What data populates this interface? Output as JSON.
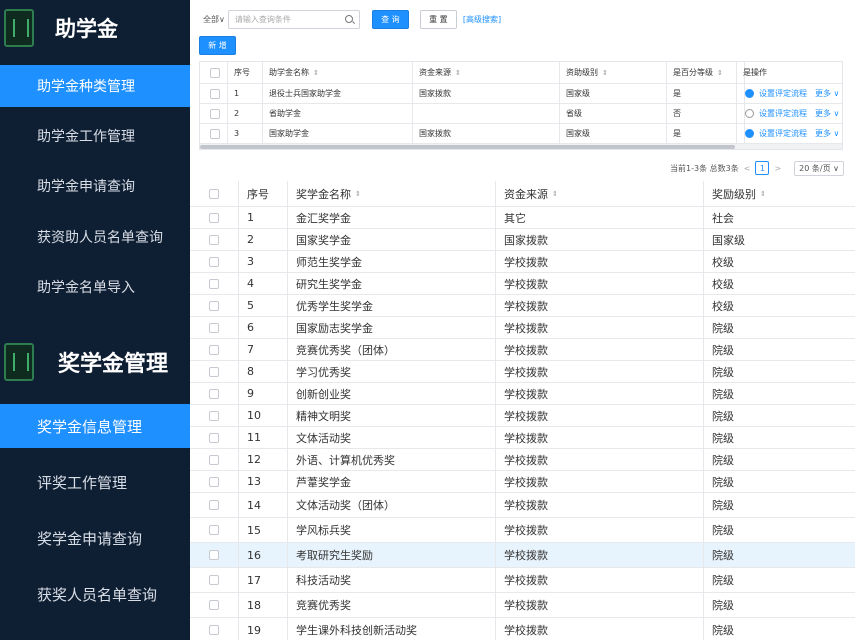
{
  "sidebar": {
    "section1_title": "助学金",
    "section1_items": [
      {
        "label": "助学金种类管理",
        "active": true
      },
      {
        "label": "助学金工作管理",
        "active": false
      },
      {
        "label": "助学金申请查询",
        "active": false
      },
      {
        "label": "获资助人员名单查询",
        "active": false
      },
      {
        "label": "助学金名单导入",
        "active": false
      }
    ],
    "section2_title": "奖学金管理",
    "section2_items": [
      {
        "label": "奖学金信息管理",
        "active": true
      },
      {
        "label": "评奖工作管理",
        "active": false
      },
      {
        "label": "奖学金申请查询",
        "active": false
      },
      {
        "label": "获奖人员名单查询",
        "active": false
      }
    ]
  },
  "toolbar": {
    "scope_label": "全部",
    "search_placeholder": "请输入查询条件",
    "query_label": "查 询",
    "reset_label": "重 置",
    "advanced_label": "[高级搜索]",
    "new_label": "新 增"
  },
  "grant_table": {
    "headers": [
      "序号",
      "助学金名称",
      "资金来源",
      "资助级别",
      "是百分等级",
      "是",
      "操作"
    ],
    "rows": [
      {
        "no": "1",
        "name": "退役士兵国家助学金",
        "source": "国家拨款",
        "level": "国家级",
        "percent": "是",
        "toggle": true,
        "action": "设置评定流程",
        "more": "更多"
      },
      {
        "no": "2",
        "name": "省助学金",
        "source": "",
        "level": "省级",
        "percent": "否",
        "toggle": false,
        "action": "设置评定流程",
        "more": "更多"
      },
      {
        "no": "3",
        "name": "国家助学金",
        "source": "国家拨款",
        "level": "国家级",
        "percent": "是",
        "toggle": true,
        "action": "设置评定流程",
        "more": "更多"
      }
    ]
  },
  "pager": {
    "summary": "当前1-3条 总数3条",
    "prev": "<",
    "current": "1",
    "next": ">",
    "size": "20 条/页"
  },
  "scholarship_table": {
    "headers": [
      "序号",
      "奖学金名称",
      "资金来源",
      "奖励级别"
    ],
    "rows": [
      {
        "no": "1",
        "name": "金汇奖学金",
        "source": "其它",
        "level": "社会"
      },
      {
        "no": "2",
        "name": "国家奖学金",
        "source": "国家拨款",
        "level": "国家级"
      },
      {
        "no": "3",
        "name": "师范生奖学金",
        "source": "学校拨款",
        "level": "校级"
      },
      {
        "no": "4",
        "name": "研究生奖学金",
        "source": "学校拨款",
        "level": "校级"
      },
      {
        "no": "5",
        "name": "优秀学生奖学金",
        "source": "学校拨款",
        "level": "校级"
      },
      {
        "no": "6",
        "name": "国家励志奖学金",
        "source": "学校拨款",
        "level": "院级"
      },
      {
        "no": "7",
        "name": "竞赛优秀奖（团体）",
        "source": "学校拨款",
        "level": "院级"
      },
      {
        "no": "8",
        "name": "学习优秀奖",
        "source": "学校拨款",
        "level": "院级"
      },
      {
        "no": "9",
        "name": "创新创业奖",
        "source": "学校拨款",
        "level": "院级"
      },
      {
        "no": "10",
        "name": "精神文明奖",
        "source": "学校拨款",
        "level": "院级"
      },
      {
        "no": "11",
        "name": "文体活动奖",
        "source": "学校拨款",
        "level": "院级"
      },
      {
        "no": "12",
        "name": "外语、计算机优秀奖",
        "source": "学校拨款",
        "level": "院级"
      },
      {
        "no": "13",
        "name": "芦葦奖学金",
        "source": "学校拨款",
        "level": "院级"
      },
      {
        "no": "14",
        "name": "文体活动奖（团体）",
        "source": "学校拨款",
        "level": "院级"
      },
      {
        "no": "15",
        "name": "学风标兵奖",
        "source": "学校拨款",
        "level": "院级"
      },
      {
        "no": "16",
        "name": "考取研究生奖励",
        "source": "学校拨款",
        "level": "院级"
      },
      {
        "no": "17",
        "name": "科技活动奖",
        "source": "学校拨款",
        "level": "院级"
      },
      {
        "no": "18",
        "name": "竞赛优秀奖",
        "source": "学校拨款",
        "level": "院级"
      },
      {
        "no": "19",
        "name": "学生课外科技创新活动奖",
        "source": "学校拨款",
        "level": "院级"
      }
    ]
  },
  "colors": {
    "accent": "#1e90ff",
    "sidebar_bg": "#0f1f33",
    "highlight_row": "#e8f4fd"
  }
}
